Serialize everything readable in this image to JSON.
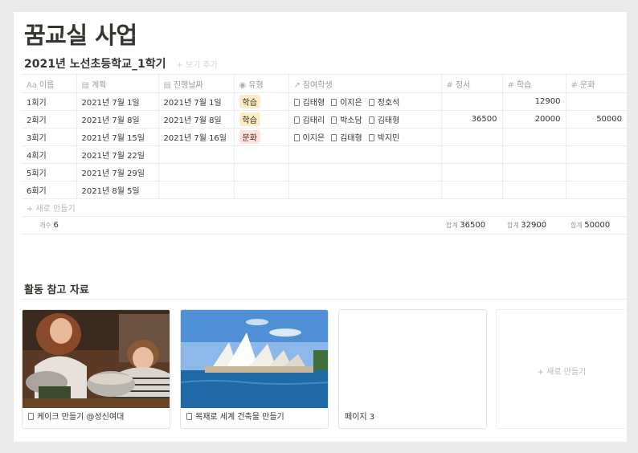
{
  "page_title": "꿈교실 사업",
  "database": {
    "title": "2021년 노선초등학교_1학기",
    "add_view": "+ 보기 추가",
    "columns": [
      {
        "icon": "Aa",
        "label": "이름"
      },
      {
        "icon": "▤",
        "label": "계획"
      },
      {
        "icon": "▤",
        "label": "진행날짜"
      },
      {
        "icon": "◉",
        "label": "유형"
      },
      {
        "icon": "↗",
        "label": "참여학생"
      },
      {
        "icon": "#",
        "label": "정서"
      },
      {
        "icon": "#",
        "label": "학습"
      },
      {
        "icon": "#",
        "label": "문화"
      }
    ],
    "rows": [
      {
        "name": "1회기",
        "plan": "2021년 7월 1일",
        "date": "2021년 7월 1일",
        "type": "학습",
        "students": [
          "김태형",
          "이지은",
          "정호석"
        ],
        "emotion": "",
        "study": "12900",
        "culture": ""
      },
      {
        "name": "2회기",
        "plan": "2021년 7월 8일",
        "date": "2021년 7월 8일",
        "type": "학습",
        "students": [
          "김태리",
          "박소담",
          "김태형"
        ],
        "emotion": "36500",
        "study": "20000",
        "culture": "50000"
      },
      {
        "name": "3회기",
        "plan": "2021년 7월 15일",
        "date": "2021년 7월 16일",
        "type": "문화",
        "students": [
          "이지은",
          "김태형",
          "박지민"
        ],
        "emotion": "",
        "study": "",
        "culture": ""
      },
      {
        "name": "4회기",
        "plan": "2021년 7월 22일",
        "date": "",
        "type": "",
        "students": [],
        "emotion": "",
        "study": "",
        "culture": ""
      },
      {
        "name": "5회기",
        "plan": "2021년 7월 29일",
        "date": "",
        "type": "",
        "students": [],
        "emotion": "",
        "study": "",
        "culture": ""
      },
      {
        "name": "6회기",
        "plan": "2021년 8월 5일",
        "date": "",
        "type": "",
        "students": [],
        "emotion": "",
        "study": "",
        "culture": ""
      }
    ],
    "new_row": "+ 새로 만들기",
    "count_label": "개수",
    "count_value": "6",
    "sum_label": "합계",
    "sums": {
      "emotion": "36500",
      "study": "32900",
      "culture": "50000"
    },
    "tag_colors": {
      "학습": "#fdecc8",
      "문화": "#ffe2dd"
    }
  },
  "gallery": {
    "title": "활동 참고 자료",
    "cards": [
      {
        "label": "케이크 만들기 @성신여대",
        "icon": "page-icon"
      },
      {
        "label": "목재로 세계 건축물 만들기",
        "icon": "page-icon"
      },
      {
        "label": "페이지 3",
        "icon": ""
      }
    ],
    "new_card": "+ 새로 만들기"
  }
}
